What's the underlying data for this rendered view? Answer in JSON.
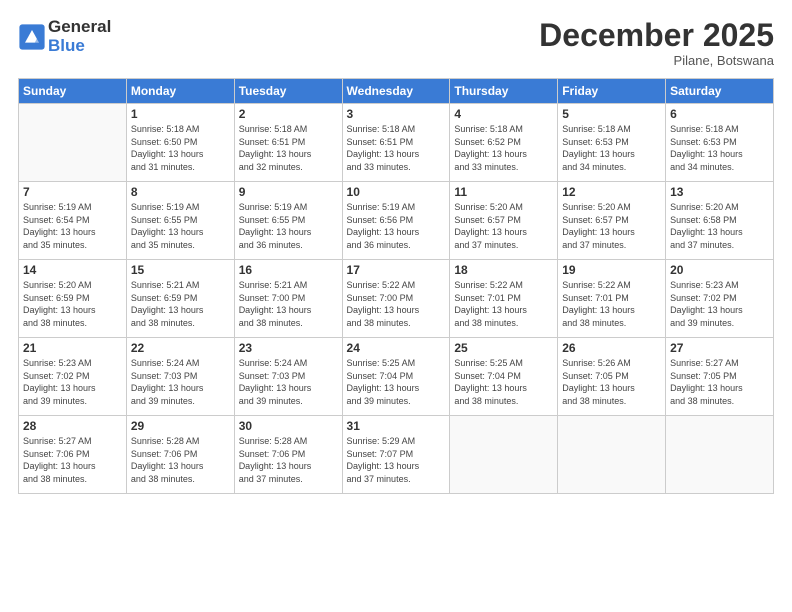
{
  "logo": {
    "general": "General",
    "blue": "Blue"
  },
  "title": "December 2025",
  "subtitle": "Pilane, Botswana",
  "days_of_week": [
    "Sunday",
    "Monday",
    "Tuesday",
    "Wednesday",
    "Thursday",
    "Friday",
    "Saturday"
  ],
  "weeks": [
    [
      {
        "day": "",
        "info": ""
      },
      {
        "day": "1",
        "info": "Sunrise: 5:18 AM\nSunset: 6:50 PM\nDaylight: 13 hours\nand 31 minutes."
      },
      {
        "day": "2",
        "info": "Sunrise: 5:18 AM\nSunset: 6:51 PM\nDaylight: 13 hours\nand 32 minutes."
      },
      {
        "day": "3",
        "info": "Sunrise: 5:18 AM\nSunset: 6:51 PM\nDaylight: 13 hours\nand 33 minutes."
      },
      {
        "day": "4",
        "info": "Sunrise: 5:18 AM\nSunset: 6:52 PM\nDaylight: 13 hours\nand 33 minutes."
      },
      {
        "day": "5",
        "info": "Sunrise: 5:18 AM\nSunset: 6:53 PM\nDaylight: 13 hours\nand 34 minutes."
      },
      {
        "day": "6",
        "info": "Sunrise: 5:18 AM\nSunset: 6:53 PM\nDaylight: 13 hours\nand 34 minutes."
      }
    ],
    [
      {
        "day": "7",
        "info": "Sunrise: 5:19 AM\nSunset: 6:54 PM\nDaylight: 13 hours\nand 35 minutes."
      },
      {
        "day": "8",
        "info": "Sunrise: 5:19 AM\nSunset: 6:55 PM\nDaylight: 13 hours\nand 35 minutes."
      },
      {
        "day": "9",
        "info": "Sunrise: 5:19 AM\nSunset: 6:55 PM\nDaylight: 13 hours\nand 36 minutes."
      },
      {
        "day": "10",
        "info": "Sunrise: 5:19 AM\nSunset: 6:56 PM\nDaylight: 13 hours\nand 36 minutes."
      },
      {
        "day": "11",
        "info": "Sunrise: 5:20 AM\nSunset: 6:57 PM\nDaylight: 13 hours\nand 37 minutes."
      },
      {
        "day": "12",
        "info": "Sunrise: 5:20 AM\nSunset: 6:57 PM\nDaylight: 13 hours\nand 37 minutes."
      },
      {
        "day": "13",
        "info": "Sunrise: 5:20 AM\nSunset: 6:58 PM\nDaylight: 13 hours\nand 37 minutes."
      }
    ],
    [
      {
        "day": "14",
        "info": "Sunrise: 5:20 AM\nSunset: 6:59 PM\nDaylight: 13 hours\nand 38 minutes."
      },
      {
        "day": "15",
        "info": "Sunrise: 5:21 AM\nSunset: 6:59 PM\nDaylight: 13 hours\nand 38 minutes."
      },
      {
        "day": "16",
        "info": "Sunrise: 5:21 AM\nSunset: 7:00 PM\nDaylight: 13 hours\nand 38 minutes."
      },
      {
        "day": "17",
        "info": "Sunrise: 5:22 AM\nSunset: 7:00 PM\nDaylight: 13 hours\nand 38 minutes."
      },
      {
        "day": "18",
        "info": "Sunrise: 5:22 AM\nSunset: 7:01 PM\nDaylight: 13 hours\nand 38 minutes."
      },
      {
        "day": "19",
        "info": "Sunrise: 5:22 AM\nSunset: 7:01 PM\nDaylight: 13 hours\nand 38 minutes."
      },
      {
        "day": "20",
        "info": "Sunrise: 5:23 AM\nSunset: 7:02 PM\nDaylight: 13 hours\nand 39 minutes."
      }
    ],
    [
      {
        "day": "21",
        "info": "Sunrise: 5:23 AM\nSunset: 7:02 PM\nDaylight: 13 hours\nand 39 minutes."
      },
      {
        "day": "22",
        "info": "Sunrise: 5:24 AM\nSunset: 7:03 PM\nDaylight: 13 hours\nand 39 minutes."
      },
      {
        "day": "23",
        "info": "Sunrise: 5:24 AM\nSunset: 7:03 PM\nDaylight: 13 hours\nand 39 minutes."
      },
      {
        "day": "24",
        "info": "Sunrise: 5:25 AM\nSunset: 7:04 PM\nDaylight: 13 hours\nand 39 minutes."
      },
      {
        "day": "25",
        "info": "Sunrise: 5:25 AM\nSunset: 7:04 PM\nDaylight: 13 hours\nand 38 minutes."
      },
      {
        "day": "26",
        "info": "Sunrise: 5:26 AM\nSunset: 7:05 PM\nDaylight: 13 hours\nand 38 minutes."
      },
      {
        "day": "27",
        "info": "Sunrise: 5:27 AM\nSunset: 7:05 PM\nDaylight: 13 hours\nand 38 minutes."
      }
    ],
    [
      {
        "day": "28",
        "info": "Sunrise: 5:27 AM\nSunset: 7:06 PM\nDaylight: 13 hours\nand 38 minutes."
      },
      {
        "day": "29",
        "info": "Sunrise: 5:28 AM\nSunset: 7:06 PM\nDaylight: 13 hours\nand 38 minutes."
      },
      {
        "day": "30",
        "info": "Sunrise: 5:28 AM\nSunset: 7:06 PM\nDaylight: 13 hours\nand 37 minutes."
      },
      {
        "day": "31",
        "info": "Sunrise: 5:29 AM\nSunset: 7:07 PM\nDaylight: 13 hours\nand 37 minutes."
      },
      {
        "day": "",
        "info": ""
      },
      {
        "day": "",
        "info": ""
      },
      {
        "day": "",
        "info": ""
      }
    ]
  ]
}
